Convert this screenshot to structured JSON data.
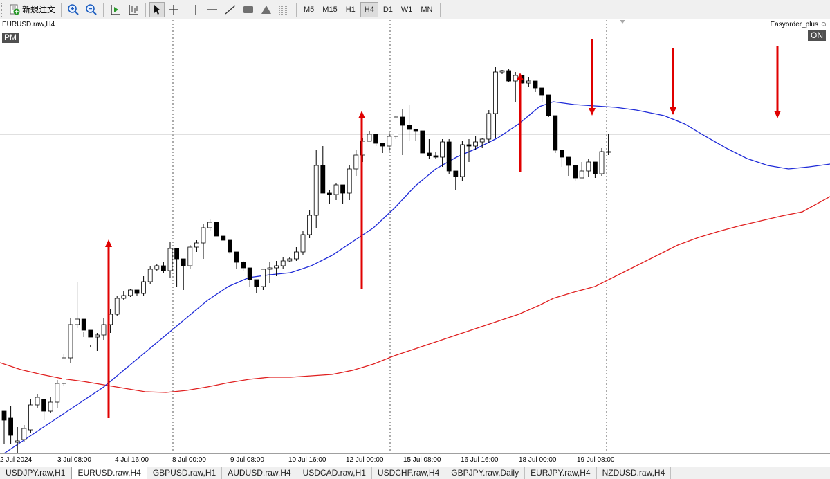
{
  "toolbar": {
    "new_order_label": "新規注文",
    "timeframes": [
      "M5",
      "M15",
      "H1",
      "H4",
      "D1",
      "W1",
      "MN"
    ],
    "active_timeframe": "H4"
  },
  "chart": {
    "symbol_label": "EURUSD.raw,H4",
    "session_badge": "PM",
    "ea_name": "Easyorder_plus",
    "ea_status": "ON",
    "ea_smiley": "☺",
    "date_labels": [
      "2 Jul 2024",
      "3 Jul 08:00",
      "4 Jul 16:00",
      "8 Jul 00:00",
      "9 Jul 08:00",
      "10 Jul 16:00",
      "12 Jul 00:00",
      "15 Jul 08:00",
      "16 Jul 16:00",
      "18 Jul 00:00",
      "19 Jul 08:00"
    ],
    "colors": {
      "bull": "#ffffff",
      "bear": "#000000",
      "ma_fast": "#1f2bd8",
      "ma_slow": "#e02020",
      "arrow": "#e00000"
    }
  },
  "chart_data": {
    "type": "candlestick",
    "series": [
      {
        "name": "EURUSD.raw H4",
        "candles": [
          [
            565,
            572,
            612,
            578
          ],
          [
            575,
            558,
            612,
            600
          ],
          [
            610,
            588,
            640,
            608
          ],
          [
            606,
            585,
            610,
            590
          ],
          [
            592,
            548,
            596,
            556
          ],
          [
            556,
            540,
            560,
            545
          ],
          [
            548,
            553,
            578,
            565
          ],
          [
            565,
            545,
            568,
            552
          ],
          [
            552,
            520,
            560,
            525
          ],
          [
            525,
            482,
            528,
            488
          ],
          [
            488,
            430,
            495,
            440
          ],
          [
            440,
            378,
            445,
            432
          ],
          [
            432,
            450,
            458,
            448
          ],
          [
            448,
            470,
            472,
            458
          ],
          [
            458,
            452,
            478,
            455
          ],
          [
            455,
            430,
            462,
            440
          ],
          [
            440,
            418,
            452,
            425
          ],
          [
            425,
            398,
            428,
            402
          ],
          [
            402,
            392,
            405,
            398
          ],
          [
            398,
            388,
            400,
            390
          ],
          [
            390,
            395,
            398,
            395
          ],
          [
            395,
            370,
            398,
            378
          ],
          [
            378,
            355,
            382,
            360
          ],
          [
            360,
            352,
            362,
            355
          ],
          [
            355,
            350,
            365,
            362
          ],
          [
            362,
            320,
            372,
            330
          ],
          [
            330,
            338,
            385,
            345
          ],
          [
            345,
            352,
            390,
            355
          ],
          [
            355,
            325,
            360,
            328
          ],
          [
            328,
            318,
            335,
            322
          ],
          [
            322,
            295,
            345,
            300
          ],
          [
            300,
            288,
            305,
            292
          ],
          [
            292,
            292,
            312,
            312
          ],
          [
            312,
            325,
            325,
            318
          ],
          [
            318,
            335,
            338,
            335
          ],
          [
            335,
            338,
            360,
            350
          ],
          [
            350,
            348,
            362,
            358
          ],
          [
            358,
            365,
            385,
            375
          ],
          [
            375,
            382,
            395,
            385
          ],
          [
            385,
            365,
            390,
            360
          ],
          [
            360,
            350,
            380,
            358
          ],
          [
            358,
            348,
            370,
            355
          ],
          [
            355,
            343,
            360,
            348
          ],
          [
            348,
            342,
            350,
            345
          ],
          [
            345,
            328,
            348,
            335
          ],
          [
            335,
            305,
            340,
            310
          ],
          [
            310,
            275,
            315,
            282
          ],
          [
            282,
            188,
            300,
            210
          ],
          [
            210,
            182,
            232,
            250
          ],
          [
            250,
            245,
            265,
            252
          ],
          [
            252,
            235,
            260,
            238
          ],
          [
            238,
            240,
            265,
            250
          ],
          [
            250,
            210,
            260,
            215
          ],
          [
            215,
            188,
            225,
            195
          ],
          [
            195,
            170,
            205,
            175
          ],
          [
            175,
            160,
            170,
            165
          ],
          [
            165,
            175,
            182,
            178
          ],
          [
            178,
            182,
            192,
            182
          ],
          [
            182,
            162,
            190,
            168
          ],
          [
            168,
            138,
            172,
            140
          ],
          [
            140,
            128,
            195,
            152
          ],
          [
            152,
            122,
            175,
            158
          ],
          [
            158,
            160,
            175,
            160
          ],
          [
            160,
            162,
            192,
            192
          ],
          [
            192,
            172,
            200,
            196
          ],
          [
            196,
            190,
            200,
            198
          ],
          [
            198,
            172,
            212,
            176
          ],
          [
            176,
            172,
            222,
            218
          ],
          [
            218,
            225,
            245,
            226
          ],
          [
            226,
            175,
            232,
            180
          ],
          [
            180,
            172,
            205,
            182
          ],
          [
            182,
            168,
            188,
            176
          ],
          [
            176,
            170,
            185,
            172
          ],
          [
            172,
            130,
            178,
            135
          ],
          [
            135,
            68,
            170,
            75
          ],
          [
            75,
            72,
            78,
            73
          ],
          [
            73,
            70,
            90,
            88
          ],
          [
            88,
            75,
            118,
            80
          ],
          [
            80,
            90,
            92,
            91
          ],
          [
            91,
            82,
            96,
            88
          ],
          [
            88,
            95,
            104,
            98
          ],
          [
            98,
            105,
            118,
            108
          ],
          [
            108,
            112,
            140,
            138
          ],
          [
            138,
            140,
            192,
            188
          ],
          [
            188,
            195,
            212,
            198
          ],
          [
            198,
            205,
            225,
            210
          ],
          [
            210,
            210,
            232,
            228
          ],
          [
            228,
            205,
            225,
            218
          ],
          [
            218,
            200,
            226,
            205
          ],
          [
            205,
            215,
            228,
            222
          ],
          [
            222,
            185,
            225,
            190
          ],
          [
            190,
            165,
            195,
            190
          ]
        ]
      },
      {
        "name": "MA fast",
        "points": [
          [
            0,
            630
          ],
          [
            30,
            610
          ],
          [
            60,
            590
          ],
          [
            90,
            570
          ],
          [
            120,
            550
          ],
          [
            150,
            530
          ],
          [
            180,
            505
          ],
          [
            210,
            480
          ],
          [
            240,
            455
          ],
          [
            270,
            430
          ],
          [
            300,
            405
          ],
          [
            330,
            385
          ],
          [
            360,
            372
          ],
          [
            390,
            368
          ],
          [
            420,
            365
          ],
          [
            450,
            355
          ],
          [
            480,
            340
          ],
          [
            510,
            320
          ],
          [
            540,
            300
          ],
          [
            570,
            272
          ],
          [
            600,
            240
          ],
          [
            630,
            215
          ],
          [
            660,
            198
          ],
          [
            690,
            185
          ],
          [
            720,
            170
          ],
          [
            750,
            150
          ],
          [
            780,
            125
          ],
          [
            800,
            118
          ],
          [
            830,
            122
          ],
          [
            860,
            124
          ],
          [
            890,
            126
          ],
          [
            920,
            130
          ],
          [
            960,
            138
          ],
          [
            990,
            150
          ],
          [
            1020,
            168
          ],
          [
            1050,
            185
          ],
          [
            1080,
            200
          ],
          [
            1110,
            210
          ],
          [
            1140,
            215
          ],
          [
            1170,
            212
          ],
          [
            1200,
            208
          ]
        ]
      },
      {
        "name": "MA slow",
        "points": [
          [
            0,
            495
          ],
          [
            30,
            505
          ],
          [
            60,
            512
          ],
          [
            90,
            518
          ],
          [
            120,
            522
          ],
          [
            150,
            527
          ],
          [
            180,
            532
          ],
          [
            210,
            537
          ],
          [
            240,
            538
          ],
          [
            270,
            535
          ],
          [
            300,
            530
          ],
          [
            330,
            524
          ],
          [
            360,
            519
          ],
          [
            390,
            516
          ],
          [
            420,
            516
          ],
          [
            450,
            514
          ],
          [
            480,
            512
          ],
          [
            510,
            506
          ],
          [
            540,
            497
          ],
          [
            570,
            485
          ],
          [
            600,
            475
          ],
          [
            630,
            465
          ],
          [
            660,
            455
          ],
          [
            690,
            445
          ],
          [
            720,
            435
          ],
          [
            750,
            425
          ],
          [
            780,
            412
          ],
          [
            800,
            402
          ],
          [
            830,
            393
          ],
          [
            860,
            385
          ],
          [
            890,
            370
          ],
          [
            920,
            355
          ],
          [
            950,
            340
          ],
          [
            980,
            325
          ],
          [
            1010,
            314
          ],
          [
            1040,
            305
          ],
          [
            1070,
            297
          ],
          [
            1100,
            290
          ],
          [
            1130,
            283
          ],
          [
            1160,
            277
          ],
          [
            1200,
            255
          ]
        ]
      }
    ]
  }
}
